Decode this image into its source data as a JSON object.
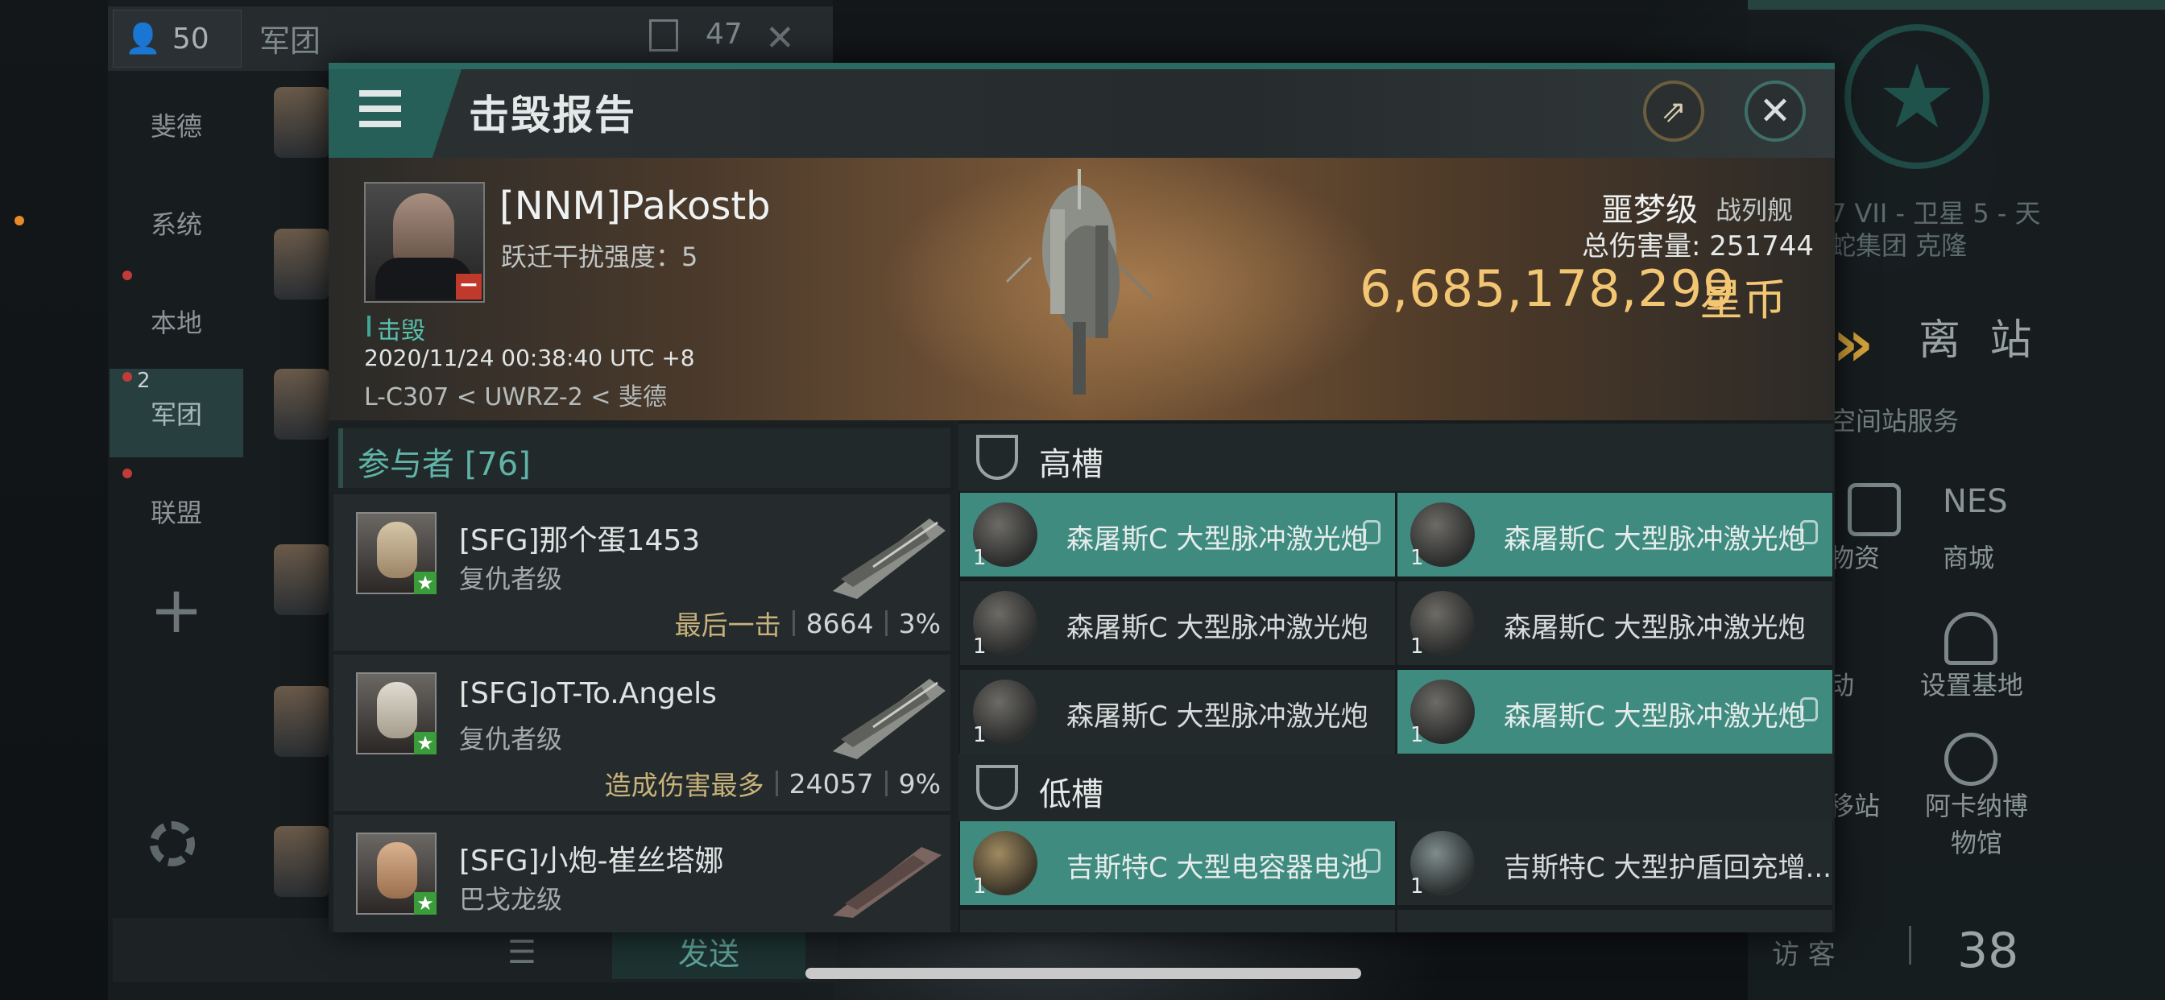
{
  "background": {
    "left_panel": {
      "online_count": "50",
      "tab_title": "军团",
      "notification_count": "47",
      "nav_items": [
        "斐德",
        "系统",
        "本地",
        "军团",
        "联盟"
      ],
      "active_nav_badge": "2",
      "send_label": "发送"
    },
    "right_panel": {
      "location_line1": "7 VII - 卫星 5 - 天",
      "location_line2": "蛇集团 克隆",
      "undock_label": "离 站",
      "services_label": "空间站服务",
      "services": [
        "物资",
        "商城",
        "动",
        "设置基地",
        "移站",
        "阿卡纳博物馆"
      ],
      "visitor_label": "访 客",
      "visitor_count": "38"
    }
  },
  "modal": {
    "title": "击毁报告",
    "victim": {
      "name": "[NNM]Pakostb",
      "warp_disrupt": "跃迁干扰强度：5",
      "status": "击毁",
      "datetime": "2020/11/24 00:38:40 UTC +8",
      "route": "L-C307 < UWRZ-2 < 斐德",
      "ship_name": "噩梦级",
      "ship_class": "战列舰",
      "total_damage": "总伤害量: 251744",
      "value": "6,685,178,299",
      "currency": "星币"
    },
    "participants": {
      "title": "参与者 [76]",
      "rows": [
        {
          "name": "[SFG]那个蛋1453",
          "ship": "复仇者级",
          "tag": "最后一击",
          "damage": "8664",
          "percent": "3%"
        },
        {
          "name": "[SFG]oT-To.Angels",
          "ship": "复仇者级",
          "tag": "造成伤害最多",
          "damage": "24057",
          "percent": "9%"
        },
        {
          "name": "[SFG]小炮-崔丝塔娜",
          "ship": "巴戈龙级",
          "tag": "",
          "damage": "",
          "percent": ""
        }
      ]
    },
    "high_slots": {
      "label": "高槽",
      "modules": [
        {
          "name": "森屠斯C 大型脉冲激光炮",
          "qty": "1"
        },
        {
          "name": "森屠斯C 大型脉冲激光炮",
          "qty": "1"
        },
        {
          "name": "森屠斯C 大型脉冲激光炮",
          "qty": "1"
        },
        {
          "name": "森屠斯C 大型脉冲激光炮",
          "qty": "1"
        },
        {
          "name": "森屠斯C 大型脉冲激光炮",
          "qty": "1"
        },
        {
          "name": "森屠斯C 大型脉冲激光炮",
          "qty": "1"
        }
      ]
    },
    "low_slots": {
      "label": "低槽",
      "modules": [
        {
          "name": "吉斯特C 大型电容器电池",
          "qty": "1"
        },
        {
          "name": "吉斯特C 大型护盾回充增...",
          "qty": "1"
        }
      ]
    }
  }
}
